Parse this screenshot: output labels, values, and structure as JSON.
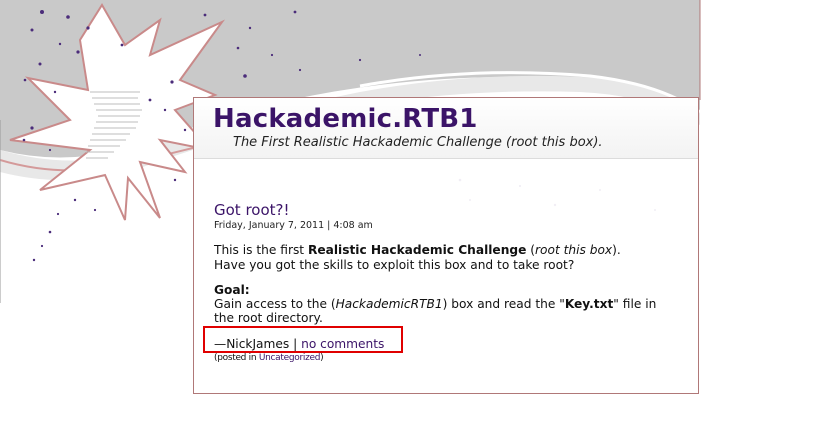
{
  "site": {
    "title": "Hackademic.RTB1",
    "description": "The First Realistic Hackademic Challenge (root this box)."
  },
  "post": {
    "title": "Got root?!",
    "date": "Friday, January 7, 2011 | 4:08 am",
    "intro_pre": "This is the first ",
    "intro_bold": "Realistic Hackademic Challenge",
    "intro_mid": " (",
    "intro_italic": "root this box",
    "intro_post": ").",
    "intro_line2": "Have you got the skills to exploit this box and to take root?",
    "goal_heading": "Goal:",
    "goal_pre": "Gain access to the (",
    "goal_italic": "HackademicRTB1",
    "goal_mid": ") box and read the \"",
    "goal_bold": "Key.txt",
    "goal_post": "\" file in",
    "goal_line2": "the root directory."
  },
  "meta": {
    "author": "—NickJames",
    "separator": "|",
    "comments": "no comments",
    "posted_in_prefix": "(posted in ",
    "category": "Uncategorized",
    "posted_in_suffix": ")"
  },
  "colors": {
    "link": "#3b1468",
    "highlight": "#e00000",
    "sky_gray": "#c9c9c9",
    "star_outline": "#c98a8a",
    "dots": "#4b2c7a"
  },
  "icons": [
    "starburst-decoration"
  ]
}
